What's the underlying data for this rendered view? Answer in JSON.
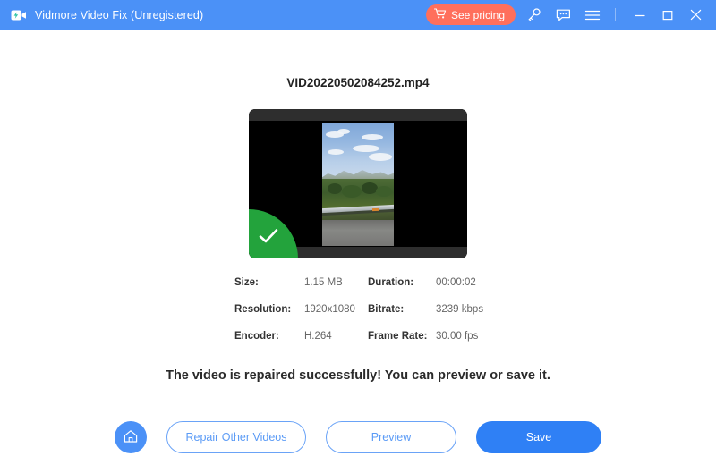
{
  "titlebar": {
    "app_title": "Vidmore Video Fix (Unregistered)",
    "logo_icon": "video-camera-lightning-icon",
    "pricing_label": "See pricing",
    "pricing_icon": "shopping-cart-icon",
    "pricing_color": "#ff6f5c",
    "bar_color": "#4b91f7",
    "icons": [
      {
        "name": "key-icon"
      },
      {
        "name": "feedback-icon"
      },
      {
        "name": "menu-icon"
      }
    ],
    "window_controls": [
      {
        "name": "minimize-button"
      },
      {
        "name": "maximize-button"
      },
      {
        "name": "close-button"
      }
    ]
  },
  "main": {
    "file_name": "VID20220502084252.mp4",
    "thumbnail": {
      "badge_icon": "success-check-icon",
      "badge_color": "#23a33c"
    },
    "metadata": {
      "rows": [
        {
          "label1": "Size:",
          "value1": "1.15 MB",
          "label2": "Duration:",
          "value2": "00:00:02"
        },
        {
          "label1": "Resolution:",
          "value1": "1920x1080",
          "label2": "Bitrate:",
          "value2": "3239 kbps"
        },
        {
          "label1": "Encoder:",
          "value1": "H.264",
          "label2": "Frame Rate:",
          "value2": "30.00 fps"
        }
      ]
    },
    "status_text": "The video is repaired successfully! You can preview or save it."
  },
  "actions": {
    "home_icon": "home-icon",
    "repair_other_label": "Repair Other Videos",
    "preview_label": "Preview",
    "save_label": "Save",
    "accent_color": "#2f80f5"
  }
}
